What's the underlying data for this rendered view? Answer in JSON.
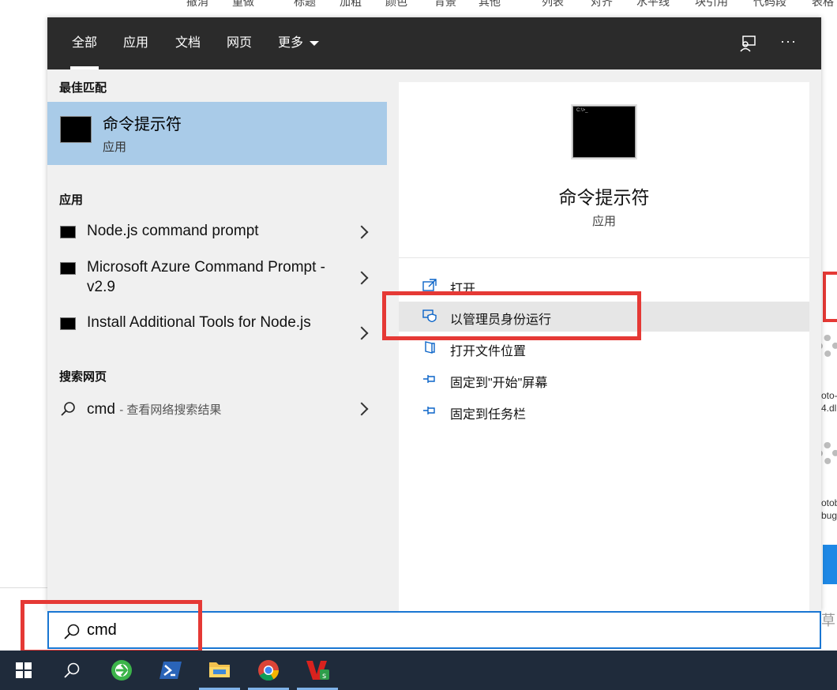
{
  "background_app": {
    "toolbar_items": [
      "撤消",
      "重做",
      "标题",
      "加粗",
      "颜色",
      "背景",
      "其他",
      "列表",
      "对齐",
      "水平线",
      "块引用",
      "代码段",
      "表格"
    ],
    "fragments": [
      "oto-",
      "4.dl",
      "otob",
      "bug",
      "草"
    ]
  },
  "tabs": [
    {
      "label": "全部",
      "active": true
    },
    {
      "label": "应用",
      "active": false
    },
    {
      "label": "文档",
      "active": false
    },
    {
      "label": "网页",
      "active": false
    },
    {
      "label": "更多",
      "active": false,
      "has_dropdown": true
    }
  ],
  "topbar_icons": [
    "feedback-icon",
    "more-options-icon"
  ],
  "more_label": "···",
  "left": {
    "best_match_header": "最佳匹配",
    "best_match": {
      "title": "命令提示符",
      "subtitle": "应用",
      "icon": "command-prompt-icon"
    },
    "apps_header": "应用",
    "apps": [
      {
        "label": "Node.js command prompt"
      },
      {
        "label": "Microsoft Azure Command Prompt - v2.9"
      },
      {
        "label": "Install Additional Tools for Node.js"
      }
    ],
    "web_header": "搜索网页",
    "web_result": {
      "query": "cmd",
      "suffix": "- 查看网络搜索结果"
    }
  },
  "preview": {
    "title": "命令提示符",
    "subtitle": "应用",
    "icon_text": "C:\\>_",
    "actions": [
      {
        "label": "打开",
        "icon": "open-icon"
      },
      {
        "label": "以管理员身份运行",
        "icon": "shield-icon",
        "highlighted": true
      },
      {
        "label": "打开文件位置",
        "icon": "folder-icon"
      },
      {
        "label": "固定到\"开始\"屏幕",
        "icon": "pin-icon"
      },
      {
        "label": "固定到任务栏",
        "icon": "pin-icon"
      }
    ]
  },
  "search": {
    "value": "cmd"
  },
  "taskbar": [
    "windows-start-icon",
    "search-icon",
    "browser-app-icon",
    "powershell-icon",
    "file-explorer-icon",
    "chrome-icon",
    "wps-icon"
  ],
  "colors": {
    "accent": "#1976d2",
    "highlight": "#e53935",
    "best_match_bg": "#a9cbe8",
    "topbar": "#2b2b2b",
    "taskbar": "#1f2b3b"
  }
}
